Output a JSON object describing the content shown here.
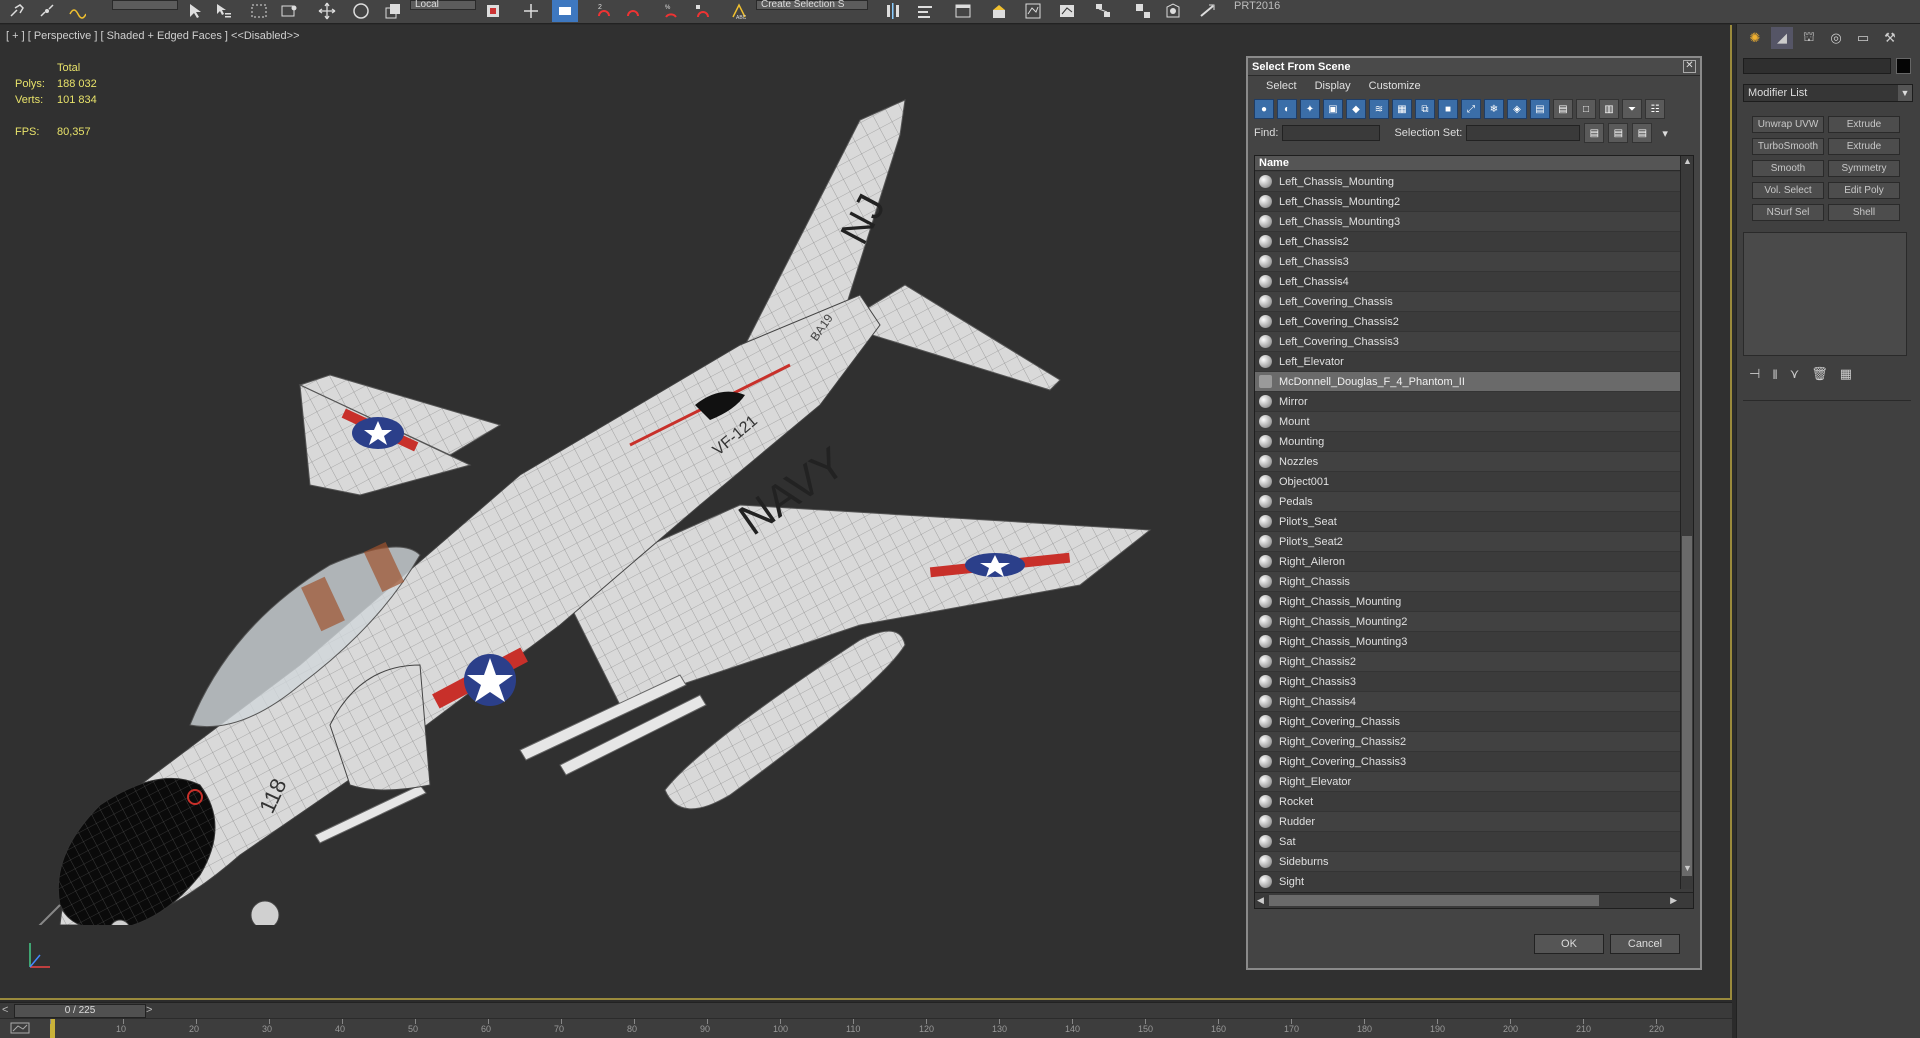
{
  "toolbar": {
    "coord_system": "Local",
    "selection_set": "Create Selection S",
    "project_label": "PRT2016"
  },
  "viewport": {
    "label": "[ + ] [ Perspective ] [ Shaded + Edged Faces ] <<Disabled>>",
    "stats": {
      "total_label": "Total",
      "polys_label": "Polys:",
      "polys_value": "188 032",
      "verts_label": "Verts:",
      "verts_value": "101 834",
      "fps_label": "FPS:",
      "fps_value": "80,357"
    },
    "decal_navy": "NAVY",
    "decal_nj": "NJ",
    "decal_vf": "VF-121",
    "decal_num": "118",
    "decal_tail_num": "BA19"
  },
  "dialog": {
    "title": "Select From Scene",
    "close": "✕",
    "menu": [
      "Select",
      "Display",
      "Customize"
    ],
    "find_label": "Find:",
    "selection_set_label": "Selection Set:",
    "column_name": "Name",
    "items": [
      "Left_Chassis_Mounting",
      "Left_Chassis_Mounting2",
      "Left_Chassis_Mounting3",
      "Left_Chassis2",
      "Left_Chassis3",
      "Left_Chassis4",
      "Left_Covering_Chassis",
      "Left_Covering_Chassis2",
      "Left_Covering_Chassis3",
      "Left_Elevator",
      "McDonnell_Douglas_F_4_Phantom_II",
      "Mirror",
      "Mount",
      "Mounting",
      "Nozzles",
      "Object001",
      "Pedals",
      "Pilot's_Seat",
      "Pilot's_Seat2",
      "Right_Aileron",
      "Right_Chassis",
      "Right_Chassis_Mounting",
      "Right_Chassis_Mounting2",
      "Right_Chassis_Mounting3",
      "Right_Chassis2",
      "Right_Chassis3",
      "Right_Chassis4",
      "Right_Covering_Chassis",
      "Right_Covering_Chassis2",
      "Right_Covering_Chassis3",
      "Right_Elevator",
      "Rocket",
      "Rudder",
      "Sat",
      "Sideburns",
      "Sight"
    ],
    "selected_item": "McDonnell_Douglas_F_4_Phantom_II",
    "ok": "OK",
    "cancel": "Cancel"
  },
  "cmdpanel": {
    "modifier_list": "Modifier List",
    "modifiers": [
      "Unwrap UVW",
      "Extrude",
      "TurboSmooth",
      "Extrude",
      "Smooth",
      "Symmetry",
      "Vol. Select",
      "Edit Poly",
      "NSurf Sel",
      "Shell"
    ]
  },
  "timeslider": {
    "frame": "0 / 225",
    "prev": "<",
    "next": ">",
    "ticks": [
      0,
      10,
      20,
      30,
      40,
      50,
      60,
      70,
      80,
      90,
      100,
      110,
      120,
      130,
      140,
      150,
      160,
      170,
      180,
      190,
      200,
      210,
      220
    ]
  },
  "colors": {
    "viewport_border": "#9a8a3c",
    "stats_text": "#e8e26a",
    "navy_blue": "#2b3f8a",
    "insignia_red": "#c8302a"
  }
}
